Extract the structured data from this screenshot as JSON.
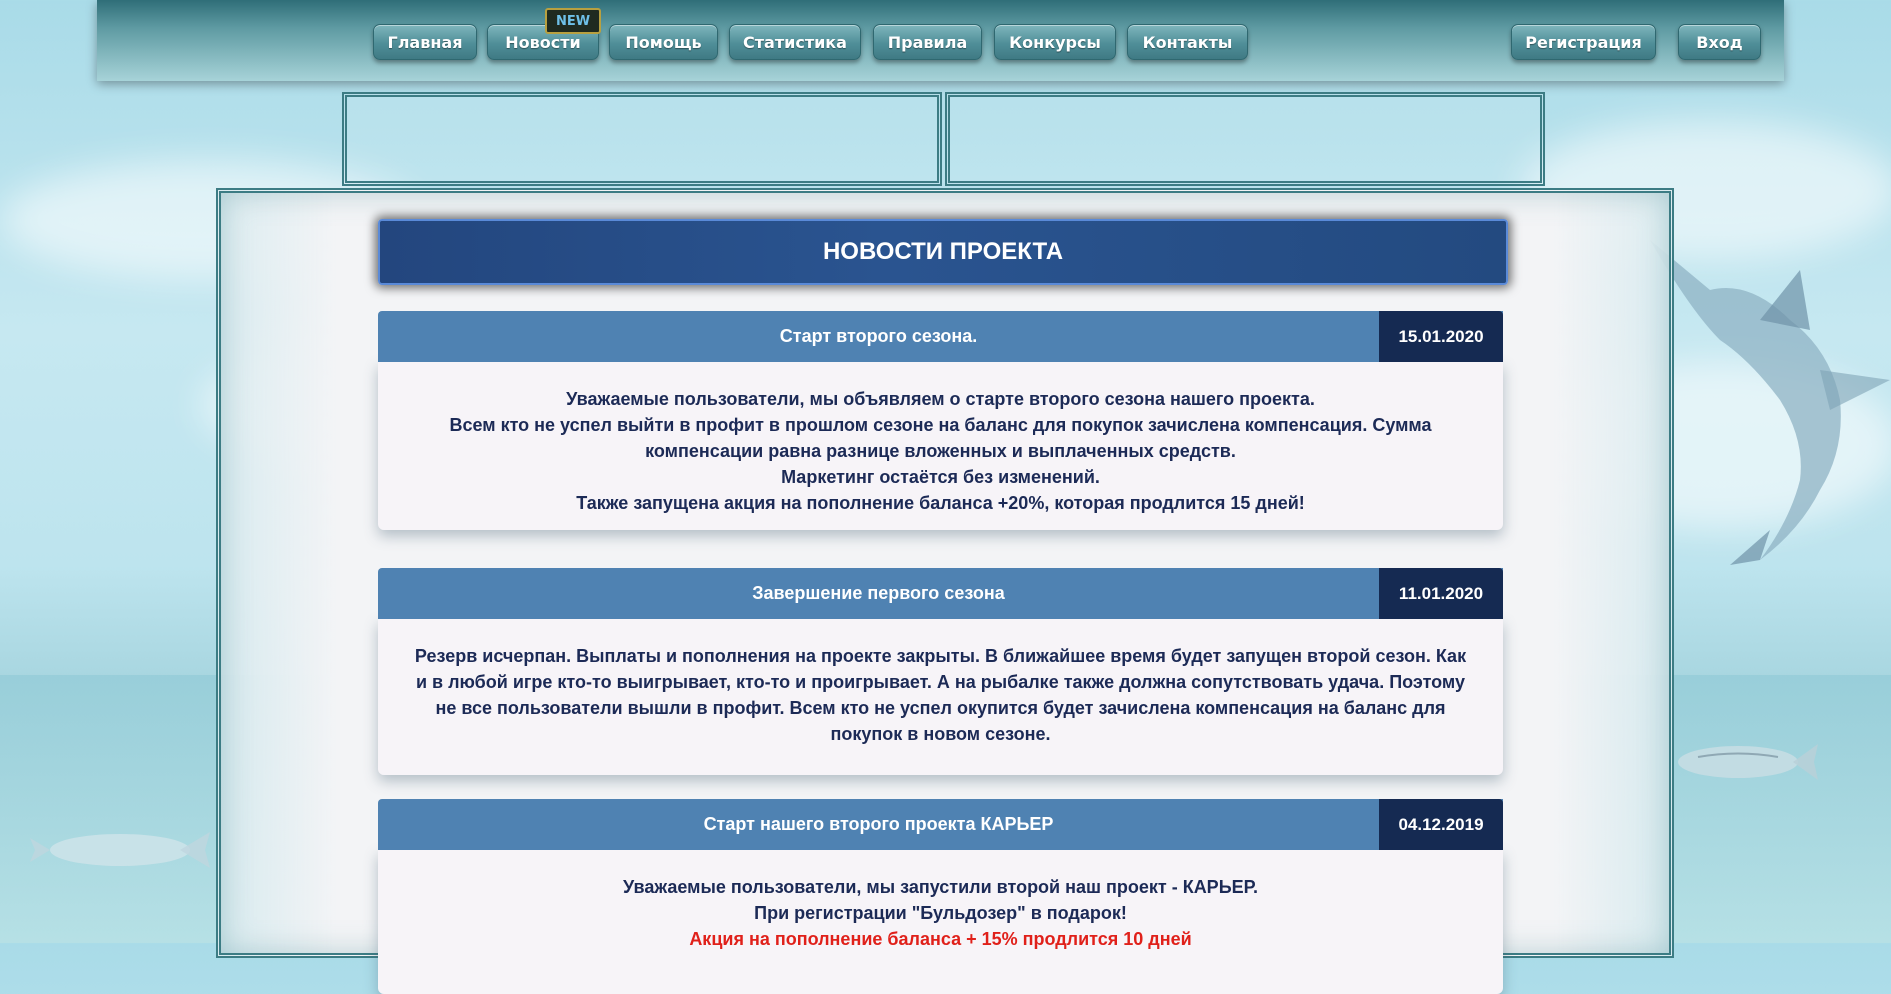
{
  "nav": {
    "items": [
      {
        "label": "Главная"
      },
      {
        "label": "Новости"
      },
      {
        "label": "Помощь"
      },
      {
        "label": "Статистика"
      },
      {
        "label": "Правила"
      },
      {
        "label": "Конкурсы"
      },
      {
        "label": "Контакты"
      }
    ],
    "new_badge": "NEW",
    "register": "Регистрация",
    "login": "Вход"
  },
  "main": {
    "title": "НОВОСТИ ПРОЕКТА",
    "news": [
      {
        "title": "Старт второго сезона.",
        "date": "15.01.2020",
        "lines": [
          "Уважаемые пользователи, мы объявляем о старте второго сезона нашего проекта.",
          "Всем кто не успел выйти в профит в прошлом сезоне на баланс для покупок зачислена компенсация. Сумма компенсации равна разнице вложенных и выплаченных средств.",
          "Маркетинг остаётся без изменений.",
          "Также запущена акция на пополнение баланса +20%, которая продлится 15 дней!"
        ]
      },
      {
        "title": "Завершение первого сезона",
        "date": "11.01.2020",
        "lines": [
          "Резерв исчерпан. Выплаты и пополнения на проекте закрыты. В ближайшее время будет запущен второй сезон. Как и в любой игре кто-то выигрывает, кто-то и проигрывает. А на рыбалке также должна сопутствовать удача. Поэтому не все пользователи вышли в профит. Всем кто не успел окупится будет зачислена компенсация на баланс для покупок в новом сезоне."
        ]
      },
      {
        "title": "Старт нашего второго проекта КАРЬЕР",
        "date": "04.12.2019",
        "lines": [
          "Уважаемые пользователи, мы запустили второй наш проект - КАРЬЕР.",
          "При регистрации \"Бульдозер\" в подарок!"
        ],
        "promo": "Акция на пополнение баланса + 15% продлится 10 дней"
      }
    ]
  },
  "colors": {
    "nav_bar": "#2f6e78",
    "title_bg": "#23467e",
    "card_head": "#4f82b2",
    "date_bg": "#152a52",
    "body_text": "#1c2a56",
    "promo_text": "#e0201a"
  }
}
